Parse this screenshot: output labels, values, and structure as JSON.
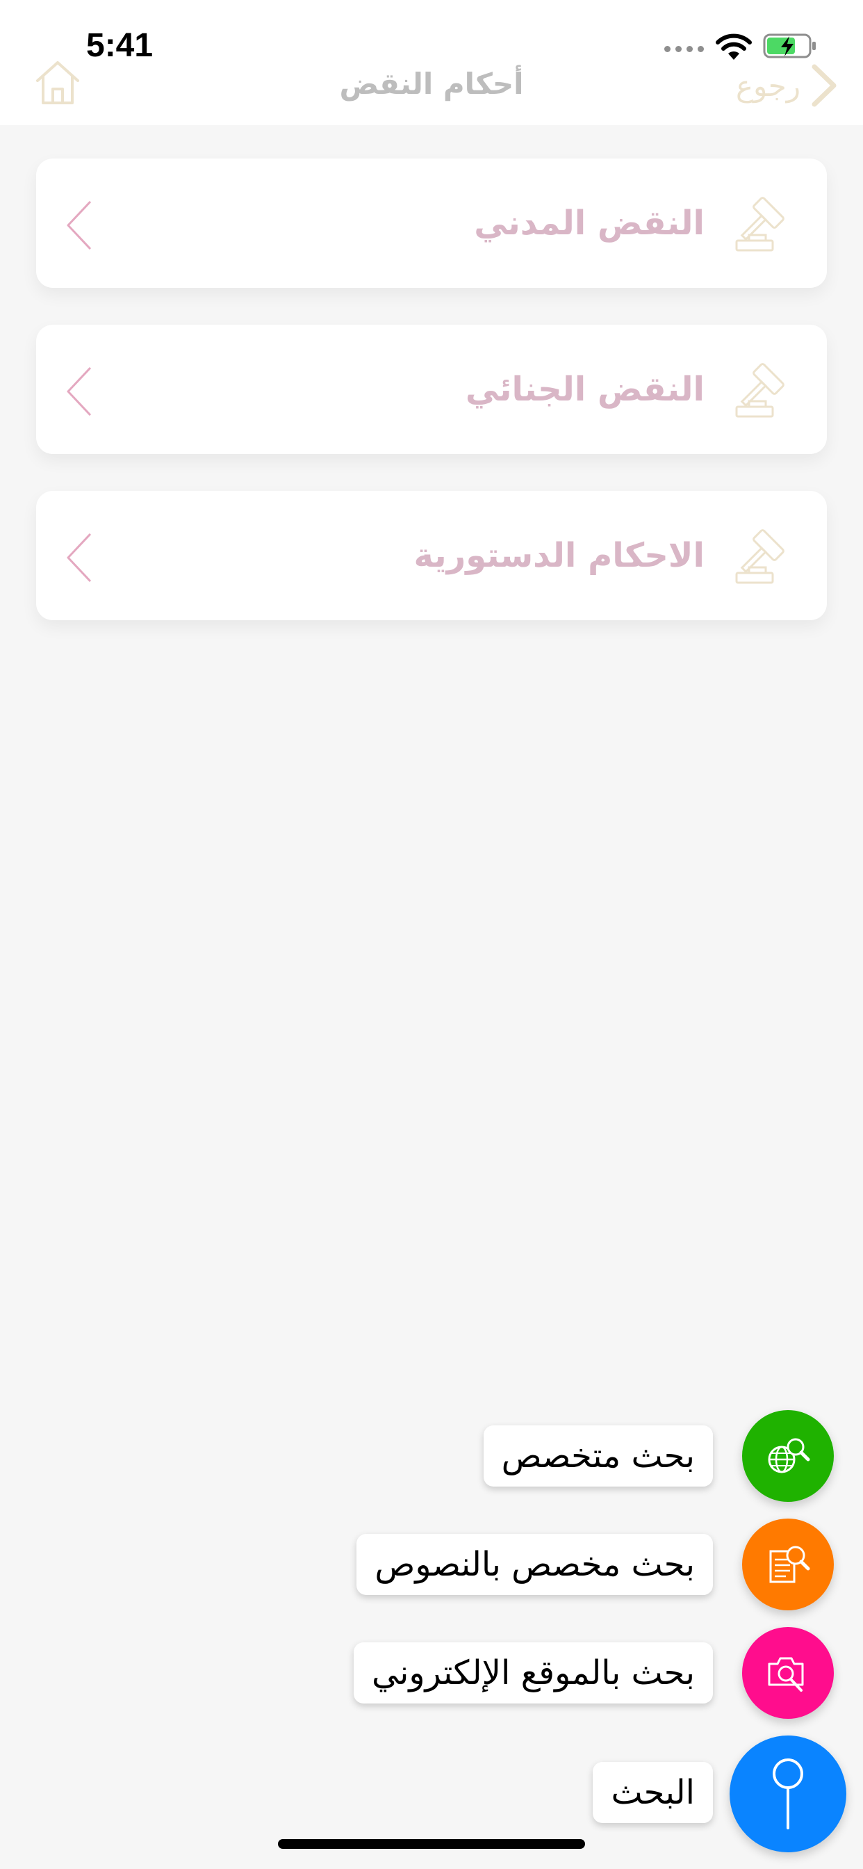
{
  "status_bar": {
    "time": "5:41"
  },
  "nav": {
    "title": "أحكام النقض",
    "back_label": "رجوع"
  },
  "menu": {
    "items": [
      {
        "label": "النقض المدني"
      },
      {
        "label": "النقض الجنائي"
      },
      {
        "label": "الاحكام الدستورية"
      }
    ]
  },
  "fab_menu": {
    "specialized": {
      "label": "بحث متخصص",
      "color": "#1fb200"
    },
    "text_search": {
      "label": "بحث مخصص بالنصوص",
      "color": "#ff7a00"
    },
    "site_search": {
      "label": "بحث بالموقع الإلكتروني",
      "color": "#ff0d8d"
    },
    "search": {
      "label": "البحث",
      "color": "#0a84ff"
    }
  },
  "colors": {
    "item_text": "#d9b6c6",
    "chevron": "#e4a8c0",
    "icon": "#ece2cc"
  }
}
